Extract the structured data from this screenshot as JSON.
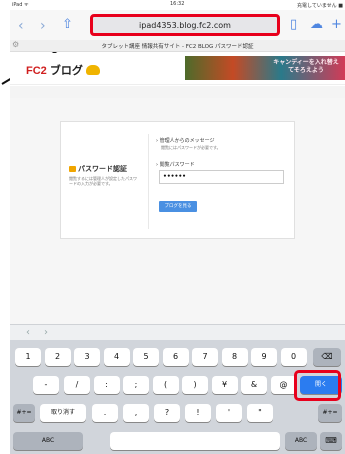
{
  "status": {
    "device": "iPad ᯤ",
    "time": "16:32",
    "battery": "充電していません ■"
  },
  "browser": {
    "back_icon": "chevron-left",
    "forward_icon": "chevron-right",
    "url": "ipad4353.blog.fc2.com",
    "tab_title": "タブレット講座 情報共有サイト - FC2 BLOG パスワード認証"
  },
  "header": {
    "logo_prefix": "FC2",
    "logo_text": " ブログ",
    "banner_text": "キャンディーを入れ替えてそろえよう"
  },
  "auth": {
    "title": "パスワード認証",
    "description": "閲覧するには管理人が設定したパスワードの入力が必要です。",
    "message_label": "› 管理人からのメッセージ",
    "message_text": "閲覧にはパスワードが必要です。",
    "password_label": "› 閲覧パスワード",
    "password_value": "••••••",
    "submit_label": "ブログを見る"
  },
  "keyboard": {
    "row1": [
      "1",
      "2",
      "3",
      "4",
      "5",
      "6",
      "7",
      "8",
      "9",
      "0"
    ],
    "row2": [
      "-",
      "/",
      ":",
      ";",
      "(",
      ")",
      "¥",
      "&",
      "@"
    ],
    "enter_label": "開く",
    "row3_left": "#+=",
    "undo_label": "取り消す",
    "row3": [
      ".",
      ",",
      "?",
      "!",
      "'",
      "\""
    ],
    "row3_right": "#+=",
    "abc_left": "ABC",
    "abc_right": "ABC",
    "accent_color": "#2b7cf0",
    "highlight_color": "#e8001c"
  }
}
